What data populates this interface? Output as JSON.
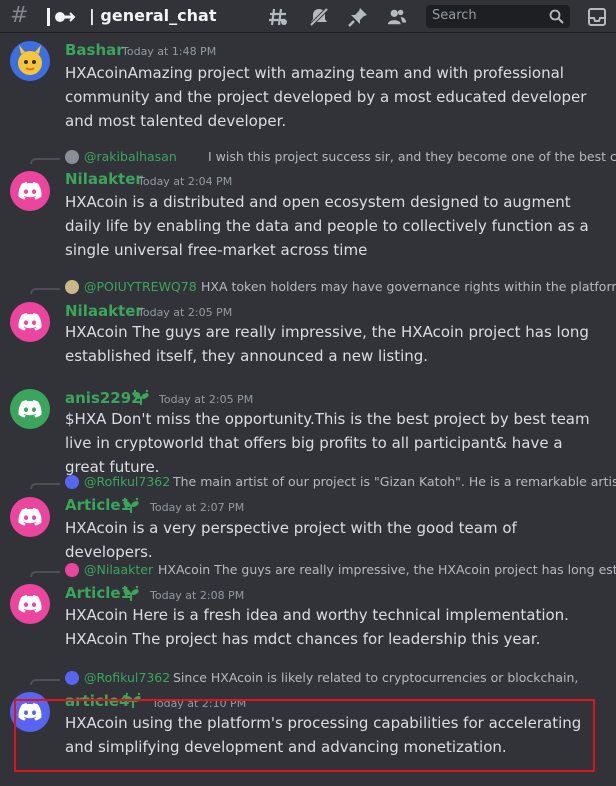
{
  "header": {
    "channel_name": "general_chat",
    "search_placeholder": "Search",
    "icons": [
      "hash-icon",
      "thread-icon",
      "threads-icon",
      "mute-icon",
      "pin-icon",
      "members-icon",
      "search-icon",
      "inbox-icon"
    ]
  },
  "messages": [
    {
      "author": "Bashar",
      "time": "Today at 1:48 PM",
      "text": "HXAcoinAmazing project with amazing team and with professional community and the project developed by a most educated developer and most talented developer."
    },
    {
      "reply_to": "@rakibalhasan",
      "reply_text": "I wish this project success sir, and they become one of the best cryptos,",
      "author": "Nilaakter",
      "time": "Today at 2:04 PM",
      "text": "HXAcoin is a distributed and open ecosystem designed to augment daily life by enabling the data and people to collectively function as a single universal free-market across time"
    },
    {
      "reply_to": "@POIUYTREWQ78",
      "reply_text": "HXA token holders may have governance rights within the platform,",
      "author": "Nilaakter",
      "time": "Today at 2:05 PM",
      "text": "HXAcoin The guys are really impressive, the HXAcoin project has long established itself, they announced a new listing."
    },
    {
      "author": "anis2292",
      "time": "Today at 2:05 PM",
      "text": "$HXA Don't miss the opportunity.This is the best project by best team live in cryptoworld that offers big profits to all participant& have a great future."
    },
    {
      "reply_to": "@Rofikul7362",
      "reply_text": "The main artist of our project is \"Gizan Katoh\". He is a remarkable artist w",
      "author": "Article1",
      "time": "Today at 2:07 PM",
      "text": "HXAcoin is a very perspective project with the good team of developers."
    },
    {
      "reply_to": "@Nilaakter",
      "reply_text": "HXAcoin The guys are really impressive, the HXAcoin project has long estab",
      "author": "Article1",
      "time": "Today at 2:08 PM",
      "text": "HXAcoin Here is a fresh idea and worthy technical implementation. HXAcoin The project has mdct chances for leadership this year."
    },
    {
      "reply_to": "@Rofikul7362",
      "reply_text": "Since HXAcoin is likely related to cryptocurrencies or blockchain,",
      "author": "article4",
      "time": "Today at 2:10 PM",
      "text": "HXAcoin using the platform's processing capabilities for accelerating and simplifying development and advancing monetization."
    }
  ],
  "colors": {
    "background": "#313338",
    "username": "#3ba55c",
    "highlight_box": "#e0141e"
  }
}
